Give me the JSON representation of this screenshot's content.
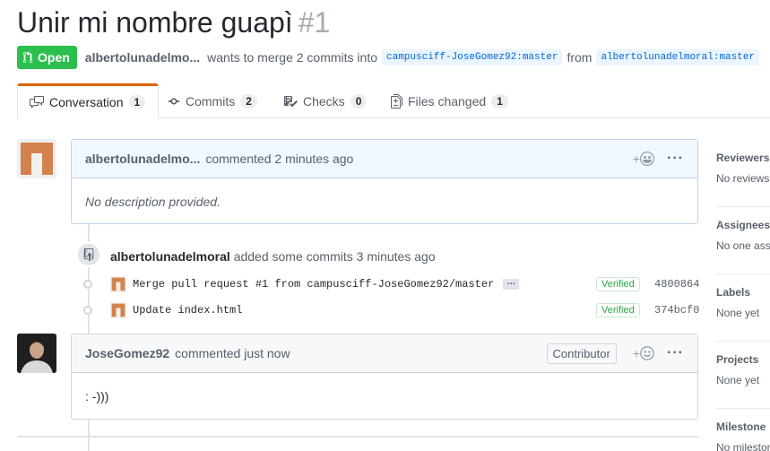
{
  "pr": {
    "title": "Unir mi nombre guapì",
    "number": "#1",
    "state": "Open",
    "author": "albertolunadelmo...",
    "meta_text": "wants to merge 2 commits into",
    "base_branch": "campusciff-JoseGomez92:master",
    "from_text": "from",
    "head_branch": "albertolunadelmoral:master"
  },
  "tabs": [
    {
      "label": "Conversation",
      "count": "1",
      "icon": "comment-discussion-icon"
    },
    {
      "label": "Commits",
      "count": "2",
      "icon": "git-commit-icon"
    },
    {
      "label": "Checks",
      "count": "0",
      "icon": "checklist-icon"
    },
    {
      "label": "Files changed",
      "count": "1",
      "icon": "file-diff-icon"
    }
  ],
  "comment1": {
    "author": "albertolunadelmo...",
    "action": "commented 2 minutes ago",
    "body": "No description provided."
  },
  "commits_event": {
    "author": "albertolunadelmoral",
    "text": "added some commits 3 minutes ago",
    "commits": [
      {
        "message": "Merge pull request #1 from campusciff-JoseGomez92/master",
        "verified": "Verified",
        "sha": "4800864",
        "has_ellipsis": true
      },
      {
        "message": "Update index.html",
        "verified": "Verified",
        "sha": "374bcf0",
        "has_ellipsis": false
      }
    ]
  },
  "comment2": {
    "author": "JoseGomez92",
    "action": "commented just now",
    "role": "Contributor",
    "body": ": -)))"
  },
  "reactions": {
    "plus": "+"
  },
  "sidebar": [
    {
      "heading": "Reviewers",
      "value": "No reviews"
    },
    {
      "heading": "Assignees",
      "value": "No one assigned"
    },
    {
      "heading": "Labels",
      "value": "None yet"
    },
    {
      "heading": "Projects",
      "value": "None yet"
    },
    {
      "heading": "Milestone",
      "value": "No milestone"
    }
  ],
  "colors": {
    "open_green": "#2cbe4e",
    "active_tab_accent": "#e36209",
    "link_blue": "#0366d6",
    "verified_green": "#28a745"
  }
}
